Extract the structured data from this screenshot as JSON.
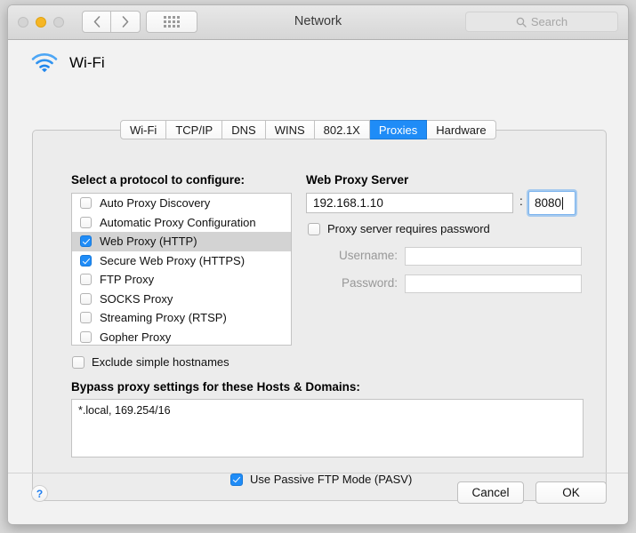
{
  "window": {
    "title": "Network",
    "search_placeholder": "Search"
  },
  "interface": {
    "name": "Wi-Fi",
    "icon": "wifi-icon"
  },
  "tabs": [
    {
      "label": "Wi-Fi",
      "active": false
    },
    {
      "label": "TCP/IP",
      "active": false
    },
    {
      "label": "DNS",
      "active": false
    },
    {
      "label": "WINS",
      "active": false
    },
    {
      "label": "802.1X",
      "active": false
    },
    {
      "label": "Proxies",
      "active": true
    },
    {
      "label": "Hardware",
      "active": false
    }
  ],
  "protocols": {
    "heading": "Select a protocol to configure:",
    "items": [
      {
        "label": "Auto Proxy Discovery",
        "checked": false,
        "selected": false
      },
      {
        "label": "Automatic Proxy Configuration",
        "checked": false,
        "selected": false
      },
      {
        "label": "Web Proxy (HTTP)",
        "checked": true,
        "selected": true
      },
      {
        "label": "Secure Web Proxy (HTTPS)",
        "checked": true,
        "selected": false
      },
      {
        "label": "FTP Proxy",
        "checked": false,
        "selected": false
      },
      {
        "label": "SOCKS Proxy",
        "checked": false,
        "selected": false
      },
      {
        "label": "Streaming Proxy (RTSP)",
        "checked": false,
        "selected": false
      },
      {
        "label": "Gopher Proxy",
        "checked": false,
        "selected": false
      }
    ]
  },
  "exclude_simple": {
    "label": "Exclude simple hostnames",
    "checked": false
  },
  "bypass": {
    "heading": "Bypass proxy settings for these Hosts & Domains:",
    "value": "*.local, 169.254/16"
  },
  "passive_ftp": {
    "label": "Use Passive FTP Mode (PASV)",
    "checked": true
  },
  "proxy_server": {
    "heading": "Web Proxy Server",
    "host": "192.168.1.10",
    "separator": ":",
    "port": "8080",
    "requires_password_label": "Proxy server requires password",
    "requires_password_checked": false,
    "username_label": "Username:",
    "username_value": "",
    "password_label": "Password:",
    "password_value": ""
  },
  "footer": {
    "help_label": "?",
    "cancel_label": "Cancel",
    "ok_label": "OK"
  },
  "colors": {
    "accent": "#1f8cf7",
    "window_bg": "#ececec",
    "amber": "#f6b625",
    "help_blue": "#1f7ef0"
  }
}
